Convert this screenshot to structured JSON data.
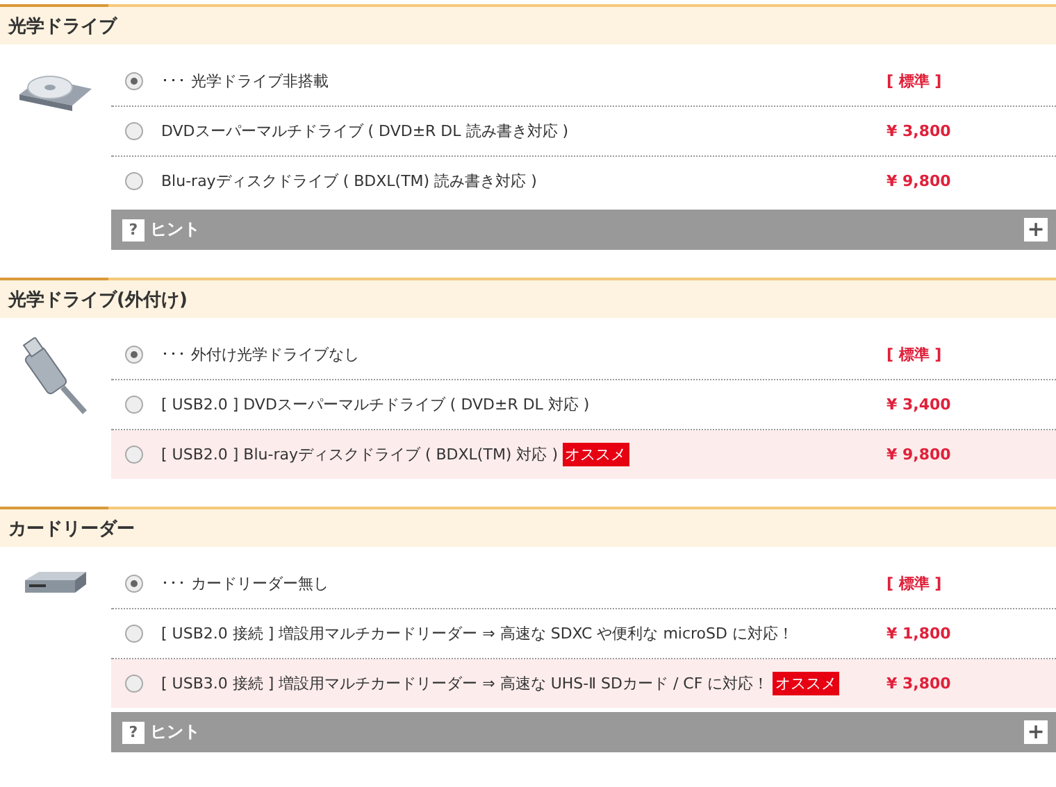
{
  "sections": [
    {
      "title": "光学ドライブ",
      "options": [
        {
          "label": "･･･ 光学ドライブ非搭載",
          "price": "[ 標準 ]",
          "selected": true,
          "recommended": false
        },
        {
          "label": "DVDスーパーマルチドライブ ( DVD±R DL 読み書き対応 )",
          "price": "¥ 3,800",
          "selected": false,
          "recommended": false
        },
        {
          "label": "Blu-rayディスクドライブ ( BDXL(TM) 読み書き対応 )",
          "price": "¥ 9,800",
          "selected": false,
          "recommended": false
        }
      ],
      "hint": {
        "mark": "?",
        "label": "ヒント",
        "toggle": "+"
      }
    },
    {
      "title": "光学ドライブ(外付け)",
      "options": [
        {
          "label": "･･･ 外付け光学ドライブなし",
          "price": "[ 標準 ]",
          "selected": true,
          "recommended": false
        },
        {
          "label": "[ USB2.0 ] DVDスーパーマルチドライブ ( DVD±R DL 対応 )",
          "price": "¥ 3,400",
          "selected": false,
          "recommended": false
        },
        {
          "label": "[ USB2.0 ] Blu-rayディスクドライブ ( BDXL(TM) 対応 )",
          "badge": "オススメ",
          "price": "¥ 9,800",
          "selected": false,
          "recommended": true
        }
      ]
    },
    {
      "title": "カードリーダー",
      "options": [
        {
          "label": "･･･ カードリーダー無し",
          "price": "[ 標準 ]",
          "selected": true,
          "recommended": false
        },
        {
          "label": "[ USB2.0 接続 ] 増設用マルチカードリーダー ⇒ 高速な SDXC や便利な microSD に対応！",
          "price": "¥ 1,800",
          "selected": false,
          "recommended": false
        },
        {
          "label": "[ USB3.0 接続 ] 増設用マルチカードリーダー ⇒ 高速な UHS-Ⅱ SDカード / CF に対応！",
          "badge": "オススメ",
          "price": "¥ 3,800",
          "selected": false,
          "recommended": true
        }
      ],
      "hint": {
        "mark": "?",
        "label": "ヒント",
        "toggle": "+"
      }
    }
  ]
}
